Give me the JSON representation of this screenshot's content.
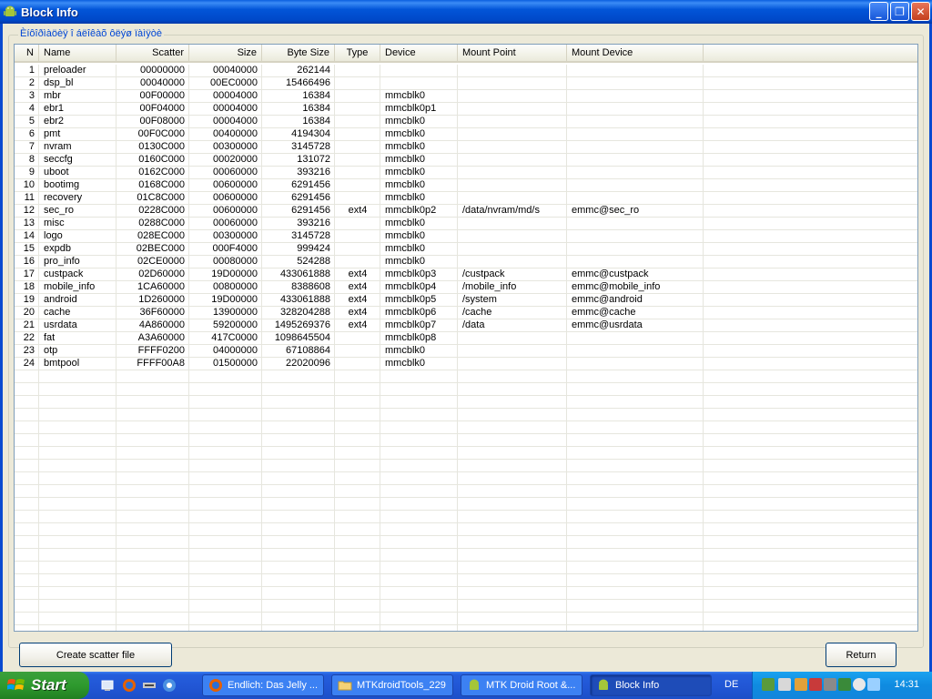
{
  "window": {
    "title": "Block Info"
  },
  "group_label": "Èíôîðìàöèÿ î áëîêàõ ôëýø ïàìÿòè",
  "columns": [
    {
      "key": "n",
      "label": "N",
      "align": "right"
    },
    {
      "key": "name",
      "label": "Name",
      "align": "left"
    },
    {
      "key": "scatter",
      "label": "Scatter",
      "align": "right"
    },
    {
      "key": "size",
      "label": "Size",
      "align": "right"
    },
    {
      "key": "bytes",
      "label": "Byte Size",
      "align": "right"
    },
    {
      "key": "type",
      "label": "Type",
      "align": "center"
    },
    {
      "key": "device",
      "label": "Device",
      "align": "left"
    },
    {
      "key": "mount",
      "label": "Mount Point",
      "align": "left"
    },
    {
      "key": "mdev",
      "label": "Mount Device",
      "align": "left"
    }
  ],
  "rows": [
    {
      "n": "1",
      "name": "preloader",
      "scatter": "00000000",
      "size": "00040000",
      "bytes": "262144",
      "type": "",
      "device": "",
      "mount": "",
      "mdev": ""
    },
    {
      "n": "2",
      "name": "dsp_bl",
      "scatter": "00040000",
      "size": "00EC0000",
      "bytes": "15466496",
      "type": "",
      "device": "",
      "mount": "",
      "mdev": ""
    },
    {
      "n": "3",
      "name": "mbr",
      "scatter": "00F00000",
      "size": "00004000",
      "bytes": "16384",
      "type": "",
      "device": "mmcblk0",
      "mount": "",
      "mdev": ""
    },
    {
      "n": "4",
      "name": "ebr1",
      "scatter": "00F04000",
      "size": "00004000",
      "bytes": "16384",
      "type": "",
      "device": "mmcblk0p1",
      "mount": "",
      "mdev": ""
    },
    {
      "n": "5",
      "name": "ebr2",
      "scatter": "00F08000",
      "size": "00004000",
      "bytes": "16384",
      "type": "",
      "device": "mmcblk0",
      "mount": "",
      "mdev": ""
    },
    {
      "n": "6",
      "name": "pmt",
      "scatter": "00F0C000",
      "size": "00400000",
      "bytes": "4194304",
      "type": "",
      "device": "mmcblk0",
      "mount": "",
      "mdev": ""
    },
    {
      "n": "7",
      "name": "nvram",
      "scatter": "0130C000",
      "size": "00300000",
      "bytes": "3145728",
      "type": "",
      "device": "mmcblk0",
      "mount": "",
      "mdev": ""
    },
    {
      "n": "8",
      "name": "seccfg",
      "scatter": "0160C000",
      "size": "00020000",
      "bytes": "131072",
      "type": "",
      "device": "mmcblk0",
      "mount": "",
      "mdev": ""
    },
    {
      "n": "9",
      "name": "uboot",
      "scatter": "0162C000",
      "size": "00060000",
      "bytes": "393216",
      "type": "",
      "device": "mmcblk0",
      "mount": "",
      "mdev": ""
    },
    {
      "n": "10",
      "name": "bootimg",
      "scatter": "0168C000",
      "size": "00600000",
      "bytes": "6291456",
      "type": "",
      "device": "mmcblk0",
      "mount": "",
      "mdev": ""
    },
    {
      "n": "11",
      "name": "recovery",
      "scatter": "01C8C000",
      "size": "00600000",
      "bytes": "6291456",
      "type": "",
      "device": "mmcblk0",
      "mount": "",
      "mdev": ""
    },
    {
      "n": "12",
      "name": "sec_ro",
      "scatter": "0228C000",
      "size": "00600000",
      "bytes": "6291456",
      "type": "ext4",
      "device": "mmcblk0p2",
      "mount": "/data/nvram/md/s",
      "mdev": "emmc@sec_ro"
    },
    {
      "n": "13",
      "name": "misc",
      "scatter": "0288C000",
      "size": "00060000",
      "bytes": "393216",
      "type": "",
      "device": "mmcblk0",
      "mount": "",
      "mdev": ""
    },
    {
      "n": "14",
      "name": "logo",
      "scatter": "028EC000",
      "size": "00300000",
      "bytes": "3145728",
      "type": "",
      "device": "mmcblk0",
      "mount": "",
      "mdev": ""
    },
    {
      "n": "15",
      "name": "expdb",
      "scatter": "02BEC000",
      "size": "000F4000",
      "bytes": "999424",
      "type": "",
      "device": "mmcblk0",
      "mount": "",
      "mdev": ""
    },
    {
      "n": "16",
      "name": "pro_info",
      "scatter": "02CE0000",
      "size": "00080000",
      "bytes": "524288",
      "type": "",
      "device": "mmcblk0",
      "mount": "",
      "mdev": ""
    },
    {
      "n": "17",
      "name": "custpack",
      "scatter": "02D60000",
      "size": "19D00000",
      "bytes": "433061888",
      "type": "ext4",
      "device": "mmcblk0p3",
      "mount": "/custpack",
      "mdev": "emmc@custpack"
    },
    {
      "n": "18",
      "name": "mobile_info",
      "scatter": "1CA60000",
      "size": "00800000",
      "bytes": "8388608",
      "type": "ext4",
      "device": "mmcblk0p4",
      "mount": "/mobile_info",
      "mdev": "emmc@mobile_info"
    },
    {
      "n": "19",
      "name": "android",
      "scatter": "1D260000",
      "size": "19D00000",
      "bytes": "433061888",
      "type": "ext4",
      "device": "mmcblk0p5",
      "mount": "/system",
      "mdev": "emmc@android"
    },
    {
      "n": "20",
      "name": "cache",
      "scatter": "36F60000",
      "size": "13900000",
      "bytes": "328204288",
      "type": "ext4",
      "device": "mmcblk0p6",
      "mount": "/cache",
      "mdev": "emmc@cache"
    },
    {
      "n": "21",
      "name": "usrdata",
      "scatter": "4A860000",
      "size": "59200000",
      "bytes": "1495269376",
      "type": "ext4",
      "device": "mmcblk0p7",
      "mount": "/data",
      "mdev": "emmc@usrdata"
    },
    {
      "n": "22",
      "name": "fat",
      "scatter": "A3A60000",
      "size": "417C0000",
      "bytes": "1098645504",
      "type": "",
      "device": "mmcblk0p8",
      "mount": "",
      "mdev": ""
    },
    {
      "n": "23",
      "name": "otp",
      "scatter": "FFFF0200",
      "size": "04000000",
      "bytes": "67108864",
      "type": "",
      "device": "mmcblk0",
      "mount": "",
      "mdev": ""
    },
    {
      "n": "24",
      "name": "bmtpool",
      "scatter": "FFFF00A8",
      "size": "01500000",
      "bytes": "22020096",
      "type": "",
      "device": "mmcblk0",
      "mount": "",
      "mdev": ""
    }
  ],
  "buttons": {
    "create_scatter": "Create scatter file",
    "return": "Return"
  },
  "taskbar": {
    "start_label": "Start",
    "tasks": [
      {
        "label": "Endlich: Das Jelly ...",
        "icon": "firefox-icon"
      },
      {
        "label": "MTKdroidTools_229",
        "icon": "folder-icon"
      },
      {
        "label": "MTK Droid Root &...",
        "icon": "android-icon"
      },
      {
        "label": "Block Info",
        "icon": "android-icon"
      }
    ],
    "language": "DE",
    "clock": "14:31"
  }
}
